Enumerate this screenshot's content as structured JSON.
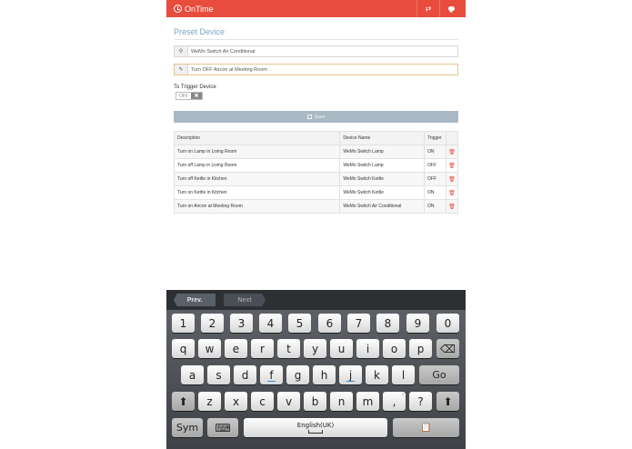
{
  "app": {
    "name": "OnTime"
  },
  "header": {
    "title": "Preset Device"
  },
  "form": {
    "device_value": "WeMo Switch Air Conditional",
    "action_value": "Turn OFF Aircon at Meeting Room",
    "trigger_label": "To Trigger Device",
    "toggle_off": "OFF",
    "toggle_knob": "✖",
    "save_label": "Save"
  },
  "table": {
    "headers": [
      "Description",
      "Device Name",
      "Trigger"
    ],
    "rows": [
      {
        "description": "Turn on Lamp in Living Room",
        "device": "WeMo Switch Lamp",
        "trigger": "ON"
      },
      {
        "description": "Turn off Lamp in Living Room",
        "device": "WeMo Switch Lamp",
        "trigger": "OFF"
      },
      {
        "description": "Turn off Kettle in Kitchen",
        "device": "WeMo Switch Kettle",
        "trigger": "OFF"
      },
      {
        "description": "Turn on Kettle in Kitchen",
        "device": "WeMo Switch Kettle",
        "trigger": "ON"
      },
      {
        "description": "Turn on Aircon at Meeting Room",
        "device": "WeMo Switch Air Conditional",
        "trigger": "ON"
      }
    ]
  },
  "keyboard": {
    "prev": "Prev.",
    "next": "Next",
    "row_numbers": [
      "1",
      "2",
      "3",
      "4",
      "5",
      "6",
      "7",
      "8",
      "9",
      "0"
    ],
    "row_q": [
      "q",
      "w",
      "e",
      "r",
      "t",
      "y",
      "u",
      "i",
      "o",
      "p"
    ],
    "row_a": [
      "a",
      "s",
      "d",
      "f",
      "g",
      "h",
      "j",
      "k",
      "l"
    ],
    "row_z": [
      "z",
      "x",
      "c",
      "v",
      "b",
      "n",
      "m",
      ",",
      "?"
    ],
    "go": "Go",
    "sym": "Sym",
    "language": "English(UK)",
    "backspace_glyph": "⌫",
    "shift_glyph": "⬆",
    "comma_sub": "!",
    "question_sub": ".",
    "clipboard_glyph": "📋",
    "keyboard_glyph": "⌨"
  },
  "colors": {
    "accent": "#e84c3d",
    "title": "#7aa6c2",
    "save_bg": "#a9b9c4"
  },
  "icons": [
    "clock-icon",
    "shuffle-icon",
    "chat-icon",
    "map-marker-icon",
    "edit-icon",
    "save-icon",
    "trash-icon",
    "backspace-icon",
    "shift-icon",
    "keyboard-settings-icon",
    "clipboard-icon"
  ]
}
